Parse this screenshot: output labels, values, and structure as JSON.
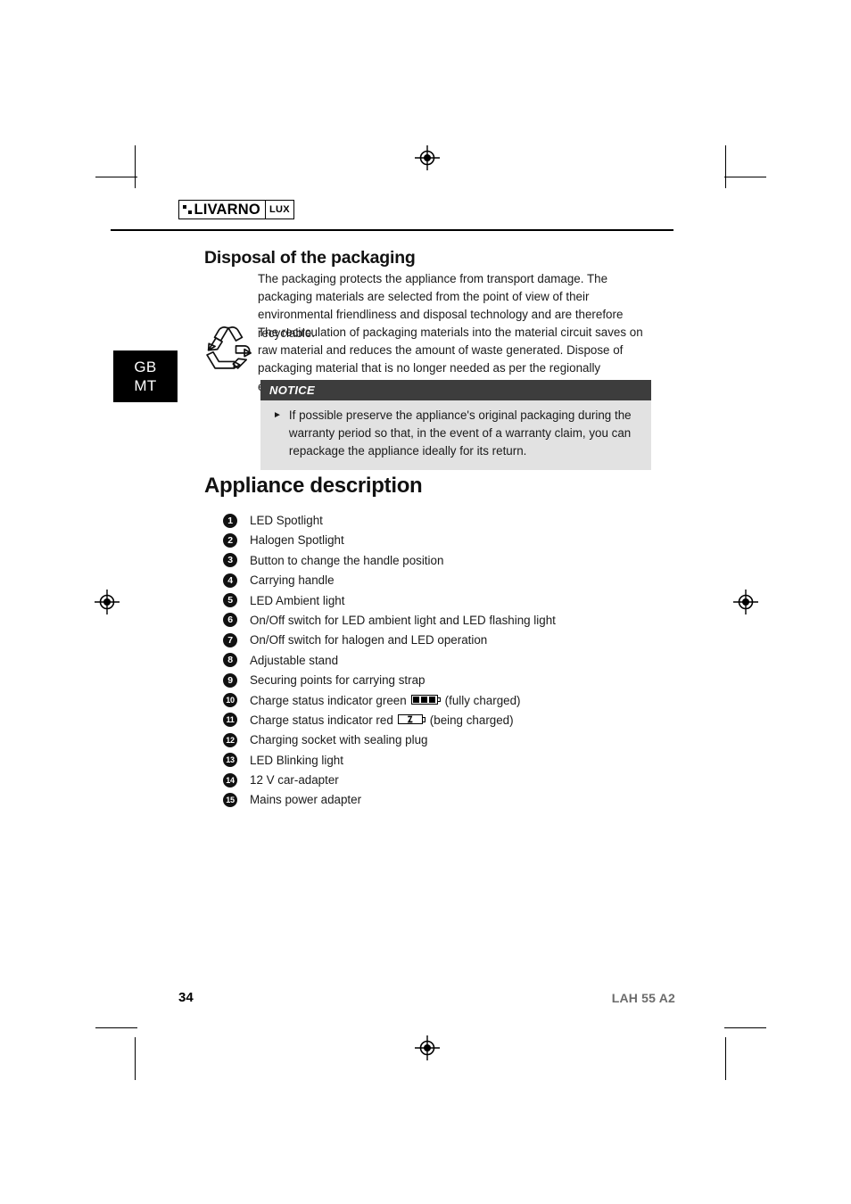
{
  "logo": {
    "word": "LIVARNO",
    "suffix": "LUX",
    "icon": "livarno-squares-icon"
  },
  "language_tab": {
    "lines": [
      "GB",
      "MT"
    ]
  },
  "sections": {
    "disposal": {
      "heading": "Disposal of the packaging",
      "paragraph_1": "The packaging protects the appliance from transport damage. The packaging materials are selected from the point of view of their environmental friendliness and disposal technology and are therefore recyclable.",
      "paragraph_2": "The recirculation of packaging materials into the material circuit saves on raw material and reduces the amount of waste generated. Dispose of packaging material that is no longer needed as per the regionally established regulations.",
      "recycle_icon": "recycling-mobius-loop-icon"
    },
    "notice": {
      "title": "NOTICE",
      "bullet_marker": "►",
      "text": "If possible preserve the appliance's original packaging during the warranty period so that, in the event of a warranty claim, you can repackage the appliance ideally for its return."
    },
    "appliance_description": {
      "heading": "Appliance description",
      "items": [
        {
          "num": "1",
          "label": "LED Spotlight"
        },
        {
          "num": "2",
          "label": "Halogen Spotlight"
        },
        {
          "num": "3",
          "label": "Button to change the handle position"
        },
        {
          "num": "4",
          "label": "Carrying handle"
        },
        {
          "num": "5",
          "label": "LED Ambient light"
        },
        {
          "num": "6",
          "label": "On/Off switch for LED ambient light and LED flashing light"
        },
        {
          "num": "7",
          "label": "On/Off switch for halogen and LED operation"
        },
        {
          "num": "8",
          "label": "Adjustable stand"
        },
        {
          "num": "9",
          "label": "Securing points for carrying strap"
        },
        {
          "num": "10",
          "label": "Charge status indicator green",
          "icon": "battery-full-icon",
          "label_after": "(fully charged)"
        },
        {
          "num": "11",
          "label": "Charge status indicator red",
          "icon": "battery-charging-icon",
          "label_after": "(being charged)"
        },
        {
          "num": "12",
          "label": "Charging socket with sealing plug"
        },
        {
          "num": "13",
          "label": "LED Blinking light"
        },
        {
          "num": "14",
          "label": "12 V car-adapter"
        },
        {
          "num": "15",
          "label": "Mains power adapter"
        }
      ]
    }
  },
  "footer": {
    "page_number": "34",
    "model": "LAH 55 A2"
  },
  "colors": {
    "notice_header_bg": "#3d3d3d",
    "notice_body_bg": "#e2e2e2",
    "lang_tab_bg": "#000000",
    "model_text": "#6b6b6b"
  }
}
